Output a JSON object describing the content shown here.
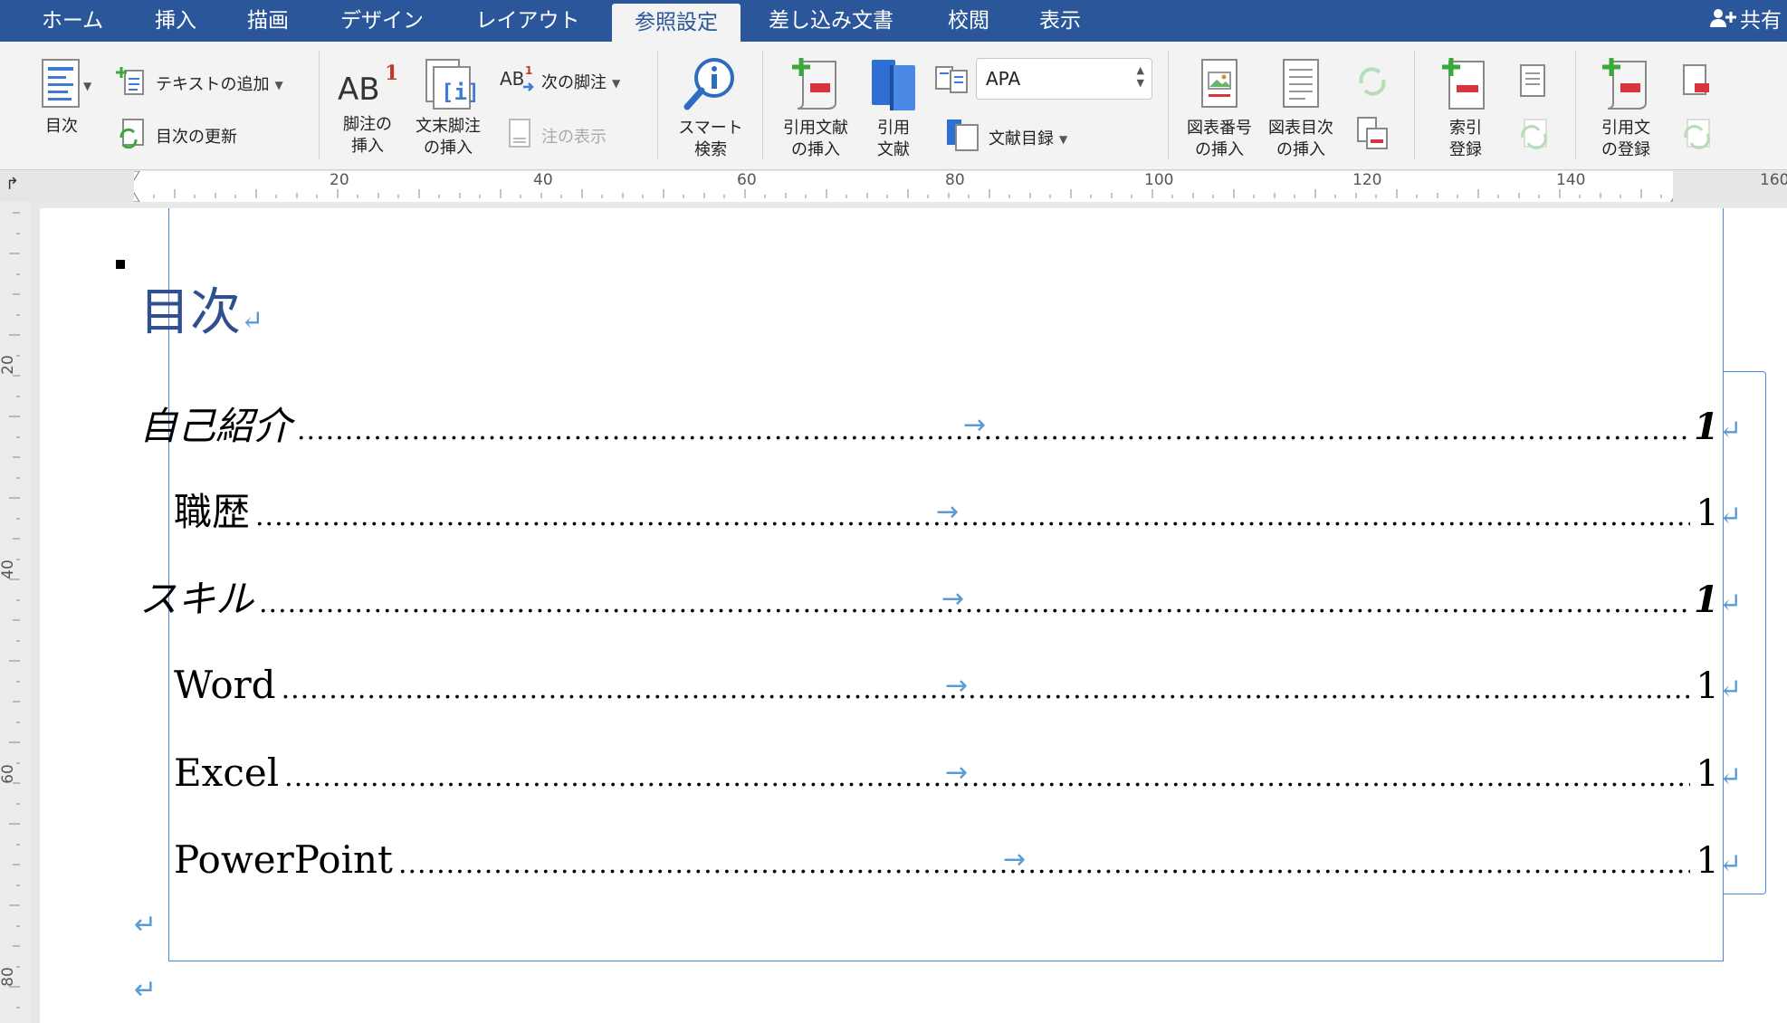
{
  "tabs": [
    "ホーム",
    "挿入",
    "描画",
    "デザイン",
    "レイアウト",
    "参照設定",
    "差し込み文書",
    "校閲",
    "表示"
  ],
  "active_tab": "参照設定",
  "share_label": "共有",
  "ribbon": {
    "toc_button": "目次",
    "add_text": "テキストの追加",
    "update_toc": "目次の更新",
    "insert_footnote_l1": "脚注の",
    "insert_footnote_l2": "挿入",
    "insert_endnote_l1": "文末脚注",
    "insert_endnote_l2": "の挿入",
    "next_footnote": "次の脚注",
    "show_notes": "注の表示",
    "smart_lookup_l1": "スマート",
    "smart_lookup_l2": "検索",
    "insert_citation_l1": "引用文献",
    "insert_citation_l2": "の挿入",
    "citations_l1": "引用",
    "citations_l2": "文献",
    "citation_style": "APA",
    "bibliography": "文献目録",
    "insert_caption_l1": "図表番号",
    "insert_caption_l2": "の挿入",
    "insert_tof_l1": "図表目次",
    "insert_tof_l2": "の挿入",
    "mark_entry_l1": "索引",
    "mark_entry_l2": "登録",
    "mark_citation_l1": "引用文",
    "mark_citation_l2": "の登録"
  },
  "ruler": {
    "h_numbers": [
      "20",
      "40",
      "60",
      "80",
      "100",
      "120",
      "140",
      "160"
    ],
    "v_numbers": [
      "20",
      "40",
      "60",
      "80"
    ]
  },
  "document": {
    "toc_title": "目次",
    "paragraph_mark": "↵",
    "tab_arrow": "→",
    "entries": [
      {
        "text": "自己紹介",
        "page": "1",
        "level": 1
      },
      {
        "text": "職歴",
        "page": "1",
        "level": 2
      },
      {
        "text": "スキル",
        "page": "1",
        "level": 1
      },
      {
        "text": "Word",
        "page": "1",
        "level": 2
      },
      {
        "text": "Excel",
        "page": "1",
        "level": 2
      },
      {
        "text": "PowerPoint",
        "page": "1",
        "level": 2
      }
    ]
  },
  "colors": {
    "tabbar": "#2b579a",
    "toc_title": "#2f4f8f",
    "frame": "#4a86d6",
    "formatting_marks": "#5b9bd5"
  }
}
